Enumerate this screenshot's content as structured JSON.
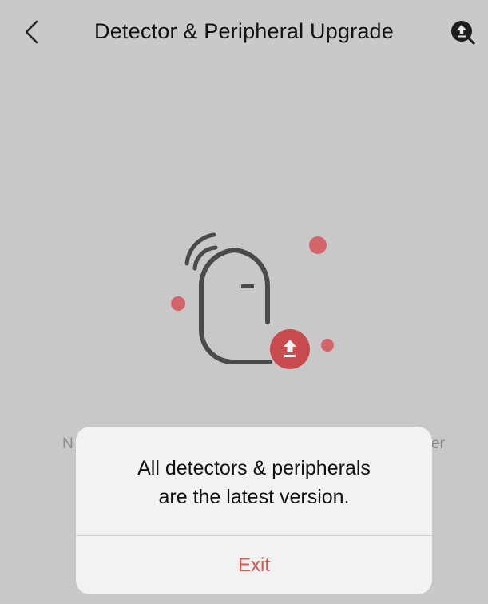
{
  "header": {
    "title": "Detector & Peripheral Upgrade"
  },
  "background": {
    "partial_left": "N",
    "partial_right": "er"
  },
  "dialog": {
    "message_line1": "All detectors & peripherals",
    "message_line2": "are the latest version.",
    "exit_label": "Exit"
  },
  "icons": {
    "back": "chevron-left-icon",
    "upgrade_search": "upload-search-icon",
    "illustration": "detector-upgrade-illustration"
  },
  "colors": {
    "accent": "#d9534f",
    "background": "#c8c8c8",
    "dialog_bg": "#f2f2f2"
  }
}
